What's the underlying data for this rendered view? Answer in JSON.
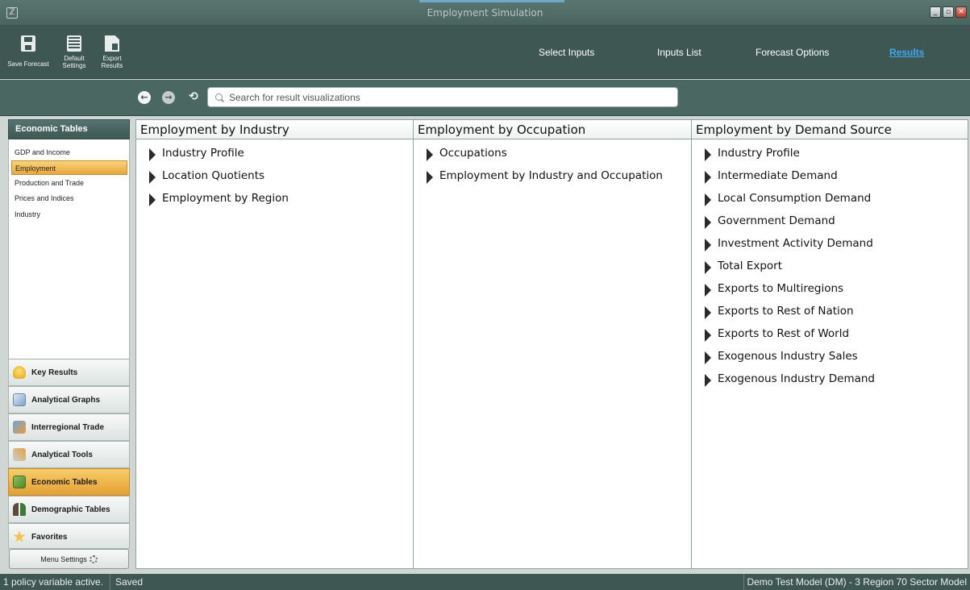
{
  "window": {
    "title": "Employment Simulation",
    "app_icon": "app-icon",
    "controls": {
      "minimize": "_",
      "maximize": "▫",
      "close": "✕"
    }
  },
  "ribbon": {
    "buttons": [
      {
        "label": "Save Forecast",
        "icon": "save-icon"
      },
      {
        "label": "Default Settings",
        "icon": "list-icon"
      },
      {
        "label": "Export Results",
        "icon": "export-icon"
      }
    ],
    "nav_tabs": [
      {
        "label": "Select Inputs",
        "active": false
      },
      {
        "label": "Inputs List",
        "active": false
      },
      {
        "label": "Forecast Options",
        "active": false
      },
      {
        "label": "Results",
        "active": true
      }
    ]
  },
  "toolbar": {
    "back_icon": "back-arrow-icon",
    "forward_icon": "forward-arrow-icon",
    "history_icon": "history-icon",
    "search": {
      "placeholder": "Search for result visualizations",
      "value": ""
    }
  },
  "sidebar": {
    "header": "Economic Tables",
    "items": [
      {
        "label": "GDP and Income",
        "active": false
      },
      {
        "label": "Employment",
        "active": true
      },
      {
        "label": "Production and Trade",
        "active": false
      },
      {
        "label": "Prices and Indices",
        "active": false
      },
      {
        "label": "Industry",
        "active": false
      }
    ],
    "categories": [
      {
        "label": "Key Results",
        "icon": "lightbulb-icon",
        "active": false
      },
      {
        "label": "Analytical Graphs",
        "icon": "graph-icon",
        "active": false
      },
      {
        "label": "Interregional Trade",
        "icon": "map-icon",
        "active": false
      },
      {
        "label": "Analytical Tools",
        "icon": "tools-icon",
        "active": false
      },
      {
        "label": "Economic Tables",
        "icon": "table-icon",
        "active": true
      },
      {
        "label": "Demographic Tables",
        "icon": "people-icon",
        "active": false
      },
      {
        "label": "Favorites",
        "icon": "star-icon",
        "active": false
      }
    ],
    "menu_settings": "Menu Settings"
  },
  "panels": [
    {
      "title": "Employment by Industry",
      "items": [
        "Industry Profile",
        "Location Quotients",
        "Employment by Region"
      ]
    },
    {
      "title": "Employment by Occupation",
      "items": [
        "Occupations",
        "Employment by Industry and Occupation"
      ]
    },
    {
      "title": "Employment by Demand Source",
      "items": [
        "Industry Profile",
        "Intermediate Demand",
        "Local Consumption Demand",
        "Government Demand",
        "Investment Activity Demand",
        "Total Export",
        "Exports to Multiregions",
        "Exports to Rest of Nation",
        "Exports to Rest of World",
        "Exogenous Industry Sales",
        "Exogenous Industry Demand"
      ]
    }
  ],
  "status": {
    "left": "1 policy variable active.",
    "saved": "Saved",
    "right": "Demo Test Model (DM) -  3 Region 70 Sector Model"
  },
  "colors": {
    "header_bg": "#3e5752",
    "active_orange": "#e9a63a",
    "results_link": "#3da8f0"
  }
}
